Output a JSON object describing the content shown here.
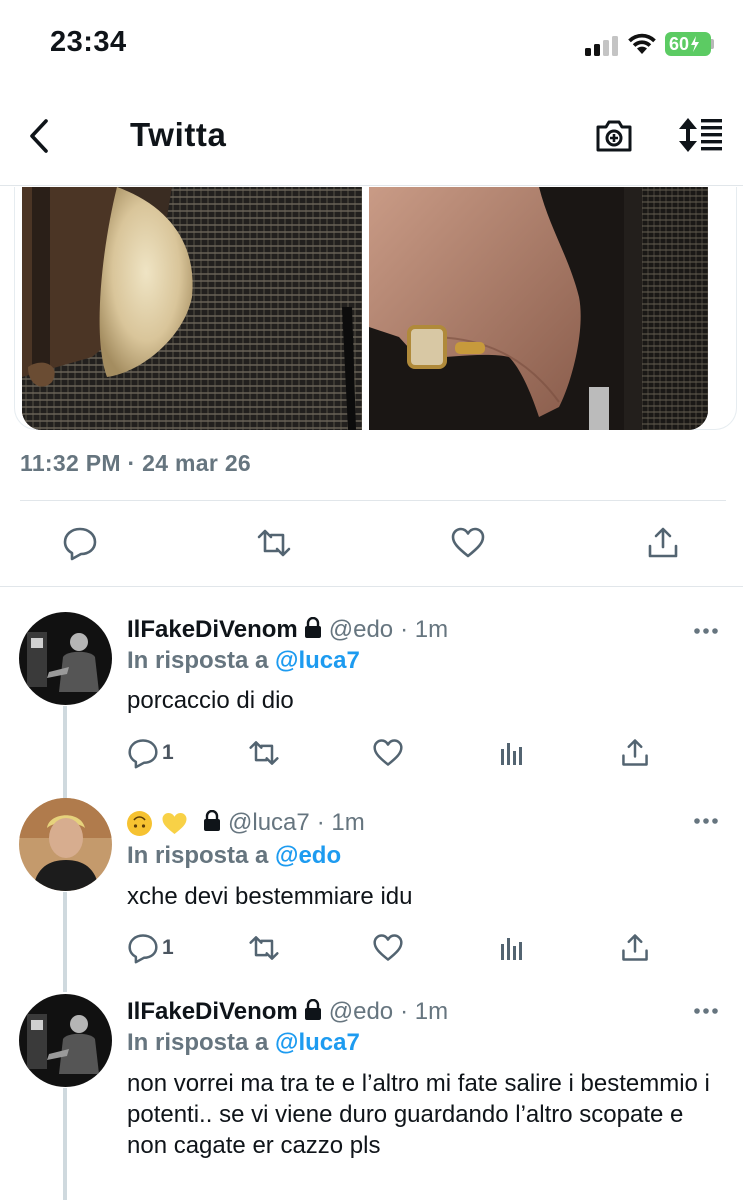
{
  "status_bar": {
    "time": "23:34",
    "battery": "60"
  },
  "header": {
    "title": "Twitta",
    "back_icon": "chevron-left-icon",
    "camera_icon": "camera-plus-icon",
    "sort_icon": "sort-lines-icon"
  },
  "tweet": {
    "timestamp": "11:32 PM · 24 mar 26",
    "media": [
      "fur-coat-photo",
      "ring-hand-photo"
    ],
    "actions": [
      "reply-icon",
      "retweet-icon",
      "like-icon",
      "share-icon"
    ]
  },
  "replies": [
    {
      "name": "IlFakeDiVenom",
      "handle": "@edo",
      "time": "· 1m",
      "reply_prefix": "In risposta a",
      "reply_to": "@luca7",
      "text": "porcaccio di dio",
      "reply_count": "1"
    },
    {
      "name": "",
      "emojis": [
        "upside-down-face-emoji",
        "yellow-heart-emoji"
      ],
      "handle": "@luca7",
      "time": "· 1m",
      "reply_prefix": "In risposta a",
      "reply_to": "@edo",
      "text": "xche devi bestemmiare idu",
      "reply_count": "1"
    },
    {
      "name": "IlFakeDiVenom",
      "handle": "@edo",
      "time": "· 1m",
      "reply_prefix": "In risposta a",
      "reply_to": "@luca7",
      "text": "non vorrei ma tra te e l’altro mi fate salire i bestemmio i potenti.. se vi viene duro guardando l’altro scopate e non cagate er cazzo pls",
      "reply_count": ""
    }
  ],
  "colors": {
    "accent": "#1d9bf0",
    "secondary_text": "#66757f",
    "battery": "#5ccb63"
  }
}
